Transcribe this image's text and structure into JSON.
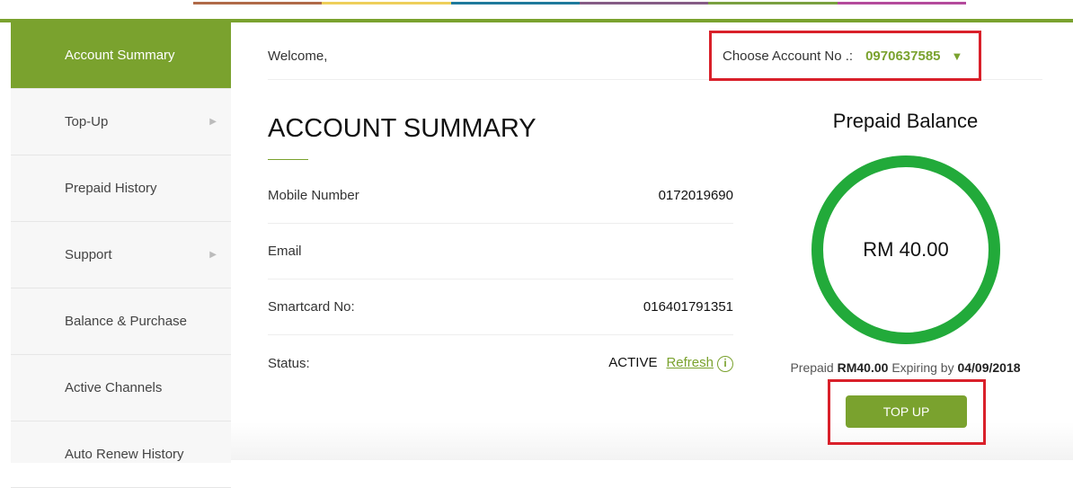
{
  "stripe_colors": [
    "#b06a48",
    "#eecf5a",
    "#1f7a9c",
    "#865c86",
    "#7aa040",
    "#b44a9c"
  ],
  "sidebar": {
    "items": [
      {
        "label": "Account Summary",
        "active": true,
        "has_submenu": false
      },
      {
        "label": "Top-Up",
        "has_submenu": true
      },
      {
        "label": "Prepaid History",
        "has_submenu": false
      },
      {
        "label": "Support",
        "has_submenu": true
      },
      {
        "label": "Balance & Purchase",
        "has_submenu": false
      },
      {
        "label": "Active Channels",
        "has_submenu": false
      },
      {
        "label": "Auto Renew History",
        "has_submenu": false
      }
    ]
  },
  "header": {
    "welcome": "Welcome,",
    "choose_label": "Choose Account No .:",
    "account_no": "0970637585"
  },
  "main": {
    "title": "ACCOUNT SUMMARY",
    "rows": [
      {
        "label": "Mobile Number",
        "value": "0172019690"
      },
      {
        "label": "Email",
        "value": ""
      },
      {
        "label": "Smartcard No:",
        "value": "016401791351"
      },
      {
        "label": "Status:",
        "value": "ACTIVE",
        "link": "Refresh"
      }
    ]
  },
  "balance": {
    "title": "Prepaid Balance",
    "amount": "RM 40.00",
    "prefix": "Prepaid",
    "amount_short": "RM40.00",
    "expiring_label": "Expiring by",
    "expiry_date": "04/09/2018",
    "button": "TOP UP"
  },
  "colors": {
    "accent": "#7aa22e",
    "ring": "#22aa3a",
    "highlight": "#d9202a"
  }
}
